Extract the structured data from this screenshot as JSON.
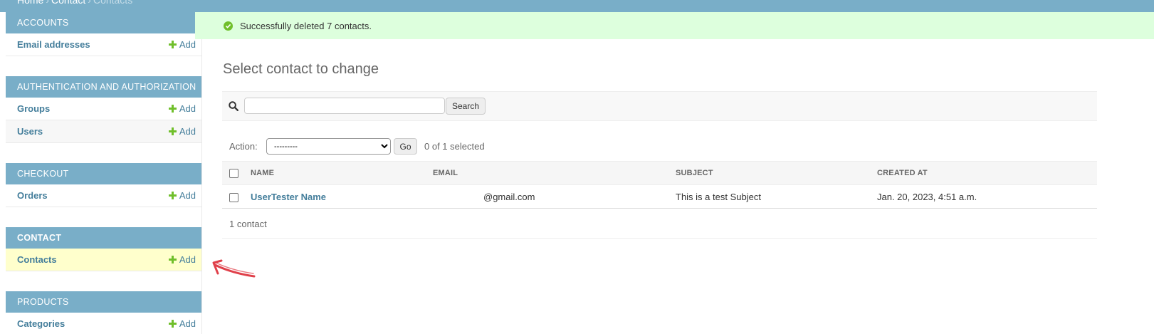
{
  "breadcrumb": {
    "home": "Home",
    "section": "Contact",
    "current": "Contacts",
    "separator": "›"
  },
  "message": {
    "text": "Successfully deleted 7 contacts.",
    "icon": "check-circle-icon",
    "color": "#70bf2b"
  },
  "sidebar": {
    "add_label": "Add",
    "modules": [
      {
        "caption": "ACCOUNTS",
        "items": [
          {
            "label": "Email addresses"
          }
        ]
      },
      {
        "caption": "AUTHENTICATION AND AUTHORIZATION",
        "items": [
          {
            "label": "Groups"
          },
          {
            "label": "Users"
          }
        ]
      },
      {
        "caption": "CHECKOUT",
        "items": [
          {
            "label": "Orders"
          }
        ]
      },
      {
        "caption": "CONTACT",
        "items": [
          {
            "label": "Contacts",
            "selected": true
          }
        ]
      },
      {
        "caption": "PRODUCTS",
        "items": [
          {
            "label": "Categories"
          }
        ]
      }
    ]
  },
  "main": {
    "title": "Select contact to change",
    "search": {
      "value": "",
      "placeholder": "",
      "button_label": "Search"
    },
    "actions": {
      "label": "Action:",
      "selected": "---------",
      "go_label": "Go",
      "counter": "0 of 1 selected"
    },
    "table": {
      "columns": [
        "NAME",
        "EMAIL",
        "SUBJECT",
        "CREATED AT"
      ],
      "rows": [
        {
          "name": "UserTester Name",
          "email": "@gmail.com",
          "subject": "This is a test Subject",
          "created_at": "Jan. 20, 2023, 4:51 a.m."
        }
      ]
    },
    "paginator": "1 contact"
  },
  "colors": {
    "header": "#79aec8",
    "link": "#447e9b",
    "success_bg": "#ddffdd",
    "selected_row": "#ffffcc",
    "add_icon": "#70bf2b",
    "annotation": "#e0404a"
  }
}
